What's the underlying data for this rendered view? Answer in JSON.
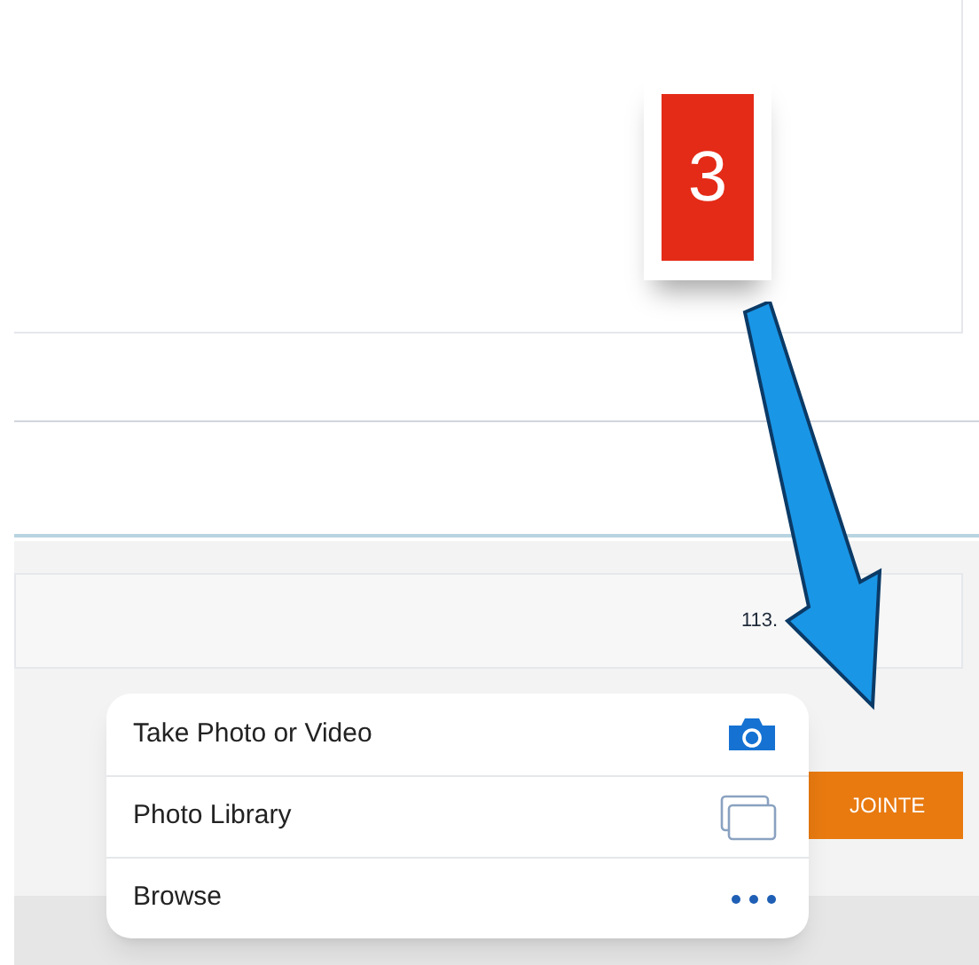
{
  "step_badge": {
    "label": "3"
  },
  "amount": "113.",
  "attach_button": {
    "label": "JOINTE"
  },
  "menu": {
    "items": [
      {
        "label": "Take Photo or Video",
        "kind": "camera"
      },
      {
        "label": "Photo Library",
        "kind": "library"
      },
      {
        "label": "Browse",
        "kind": "more"
      }
    ]
  }
}
